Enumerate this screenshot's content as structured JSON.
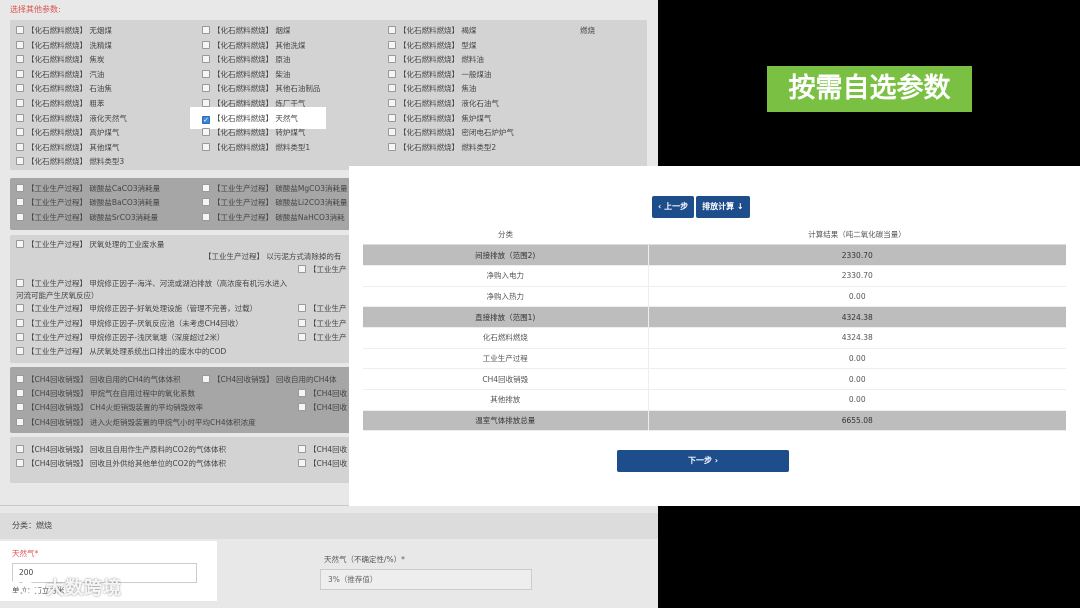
{
  "left": {
    "header": "选择其他参数:",
    "fossil_items": [
      {
        "label": "【化石燃料燃烧】 无烟煤",
        "checked": false
      },
      {
        "label": "【化石燃料燃烧】 洗精煤",
        "checked": false
      },
      {
        "label": "【化石燃料燃烧】 焦炭",
        "checked": false
      },
      {
        "label": "【化石燃料燃烧】 汽油",
        "checked": false
      },
      {
        "label": "【化石燃料燃烧】 石油焦",
        "checked": false
      },
      {
        "label": "【化石燃料燃烧】 粗苯",
        "checked": false
      },
      {
        "label": "【化石燃料燃烧】 液化天然气",
        "checked": false
      },
      {
        "label": "【化石燃料燃烧】 高炉煤气",
        "checked": false
      },
      {
        "label": "【化石燃料燃烧】 其他煤气",
        "checked": false
      },
      {
        "label": "【化石燃料燃烧】 燃料类型3",
        "checked": false
      },
      {
        "label": "【化石燃料燃烧】 烟煤",
        "checked": false
      },
      {
        "label": "【化石燃料燃烧】 其他洗煤",
        "checked": false
      },
      {
        "label": "【化石燃料燃烧】 原油",
        "checked": false
      },
      {
        "label": "【化石燃料燃烧】 柴油",
        "checked": false
      },
      {
        "label": "【化石燃料燃烧】 其他石油制品",
        "checked": false
      },
      {
        "label": "【化石燃料燃烧】 炼厂干气",
        "checked": false
      },
      {
        "label": "【化石燃料燃烧】 天然气",
        "checked": true
      },
      {
        "label": "【化石燃料燃烧】 转炉煤气",
        "checked": false
      },
      {
        "label": "【化石燃料燃烧】 燃料类型1",
        "checked": false
      },
      {
        "label": "【化石燃料燃烧】 褐煤",
        "checked": false
      },
      {
        "label": "【化石燃料燃烧】 型煤",
        "checked": false
      },
      {
        "label": "【化石燃料燃烧】 燃料油",
        "checked": false
      },
      {
        "label": "【化石燃料燃烧】 一般煤油",
        "checked": false
      },
      {
        "label": "【化石燃料燃烧】 焦油",
        "checked": false
      },
      {
        "label": "【化石燃料燃烧】 液化石油气",
        "checked": false
      },
      {
        "label": "【化石燃料燃烧】 焦炉煤气",
        "checked": false
      },
      {
        "label": "【化石燃料燃烧】 密闭电石炉炉气",
        "checked": false
      },
      {
        "label": "【化石燃料燃烧】 燃料类型2",
        "checked": false
      }
    ],
    "fossil_side_label": "燃烧",
    "industry_items": [
      {
        "label": "【工业生产过程】 碳酸盐CaCO3消耗量"
      },
      {
        "label": "【工业生产过程】 碳酸盐BaCO3消耗量"
      },
      {
        "label": "【工业生产过程】 碳酸盐SrCO3消耗量"
      },
      {
        "label": "【工业生产过程】 碳酸盐MgCO3消耗量"
      },
      {
        "label": "【工业生产过程】 碳酸盐Li2CO3消耗量"
      },
      {
        "label": "【工业生产过程】 碳酸盐NaHCO3消耗"
      }
    ],
    "waste_items": [
      {
        "label": "【工业生产过程】 厌氧处理的工业废水量"
      },
      {
        "label": "【工业生产过程】 以污泥方式清除掉的有"
      },
      {
        "label": "【工业生产过程】 甲烷修正因子-海洋、河流或湖泊排放（高浓度有机污水进入"
      },
      {
        "label": "河流可能产生厌氧反应）"
      },
      {
        "label": "【工业生产过程】 甲烷修正因子-好氧处理设施（管理不完善，过载）"
      },
      {
        "label": "【工业生产过程】 甲烷修正因子-厌氧反应池（未考虑CH4回收）"
      },
      {
        "label": "【工业生产过程】 甲烷修正因子-浅厌氧塘（深度超过2米）"
      },
      {
        "label": "【工业生产过程】 从厌氧处理系统出口排出的废水中的COD"
      },
      {
        "label": "【工业生产"
      },
      {
        "label": "【工业生产"
      },
      {
        "label": "【工业生产"
      },
      {
        "label": "【工业生产"
      }
    ],
    "ch4_items": [
      {
        "label": "【CH4回收销毁】 回收自用的CH4的气体体积"
      },
      {
        "label": "【CH4回收销毁】 甲烷气在自用过程中的氧化系数"
      },
      {
        "label": "【CH4回收销毁】 CH4火炬销毁装置的平均销毁效率"
      },
      {
        "label": "【CH4回收销毁】 进入火炬销毁装置的甲烷气小时平均CH4体积浓度"
      },
      {
        "label": "【CH4回收销毁】 回收自用的CH4体"
      },
      {
        "label": "【CH4回收"
      },
      {
        "label": "【CH4回收"
      }
    ],
    "co2_items": [
      {
        "label": "【CH4回收销毁】 回收且自用作生产原料的CO2的气体体积"
      },
      {
        "label": "【CH4回收销毁】 回收且外供给其他单位的CO2的气体体积"
      },
      {
        "label": "【CH4回收"
      },
      {
        "label": "【CH4回收"
      }
    ],
    "category_text": "分类：燃烧",
    "natural_gas": {
      "label": "天然气*",
      "value": "200",
      "unit": "单位：万立方米"
    },
    "uncertainty": {
      "label": "天然气（不确定性/%）*",
      "value": "3%（推荐值）"
    },
    "watermark": "大数跨境"
  },
  "panel": {
    "prev_button": "上一步",
    "calc_button": "排放计算",
    "next_button": "下一步",
    "headers": [
      "分类",
      "计算结果（吨二氧化碳当量）"
    ],
    "rows": [
      {
        "category": "间接排放（范围2)",
        "value": "2330.70",
        "grey": true
      },
      {
        "category": "净购入电力",
        "value": "2330.70",
        "grey": false
      },
      {
        "category": "净购入热力",
        "value": "0.00",
        "grey": false
      },
      {
        "category": "直接排放（范围1)",
        "value": "4324.38",
        "grey": true
      },
      {
        "category": "化石燃料燃烧",
        "value": "4324.38",
        "grey": false
      },
      {
        "category": "工业生产过程",
        "value": "0.00",
        "grey": false
      },
      {
        "category": "CH4回收销毁",
        "value": "0.00",
        "grey": false
      },
      {
        "category": "其他排放",
        "value": "0.00",
        "grey": false
      },
      {
        "category": "温室气体排放总量",
        "value": "6655.08",
        "grey": true
      }
    ]
  },
  "callout": "按需自选参数",
  "colors": {
    "accent": "#1e4d8c",
    "callout": "#7ac043",
    "label_red": "#d9534f"
  }
}
